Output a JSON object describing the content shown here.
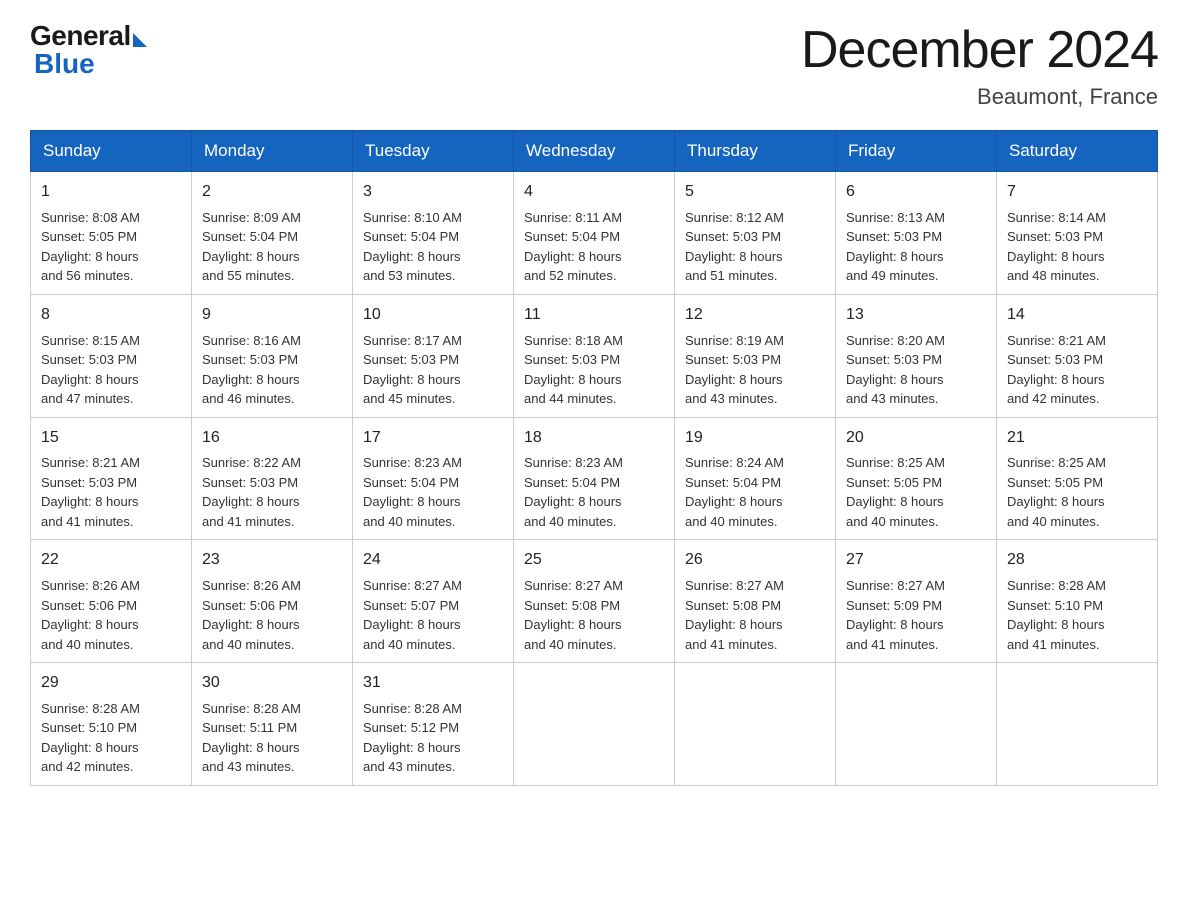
{
  "logo": {
    "general": "General",
    "blue": "Blue"
  },
  "header": {
    "month": "December 2024",
    "location": "Beaumont, France"
  },
  "weekdays": [
    "Sunday",
    "Monday",
    "Tuesday",
    "Wednesday",
    "Thursday",
    "Friday",
    "Saturday"
  ],
  "weeks": [
    [
      {
        "day": "1",
        "sunrise": "8:08 AM",
        "sunset": "5:05 PM",
        "daylight": "8 hours and 56 minutes."
      },
      {
        "day": "2",
        "sunrise": "8:09 AM",
        "sunset": "5:04 PM",
        "daylight": "8 hours and 55 minutes."
      },
      {
        "day": "3",
        "sunrise": "8:10 AM",
        "sunset": "5:04 PM",
        "daylight": "8 hours and 53 minutes."
      },
      {
        "day": "4",
        "sunrise": "8:11 AM",
        "sunset": "5:04 PM",
        "daylight": "8 hours and 52 minutes."
      },
      {
        "day": "5",
        "sunrise": "8:12 AM",
        "sunset": "5:03 PM",
        "daylight": "8 hours and 51 minutes."
      },
      {
        "day": "6",
        "sunrise": "8:13 AM",
        "sunset": "5:03 PM",
        "daylight": "8 hours and 49 minutes."
      },
      {
        "day": "7",
        "sunrise": "8:14 AM",
        "sunset": "5:03 PM",
        "daylight": "8 hours and 48 minutes."
      }
    ],
    [
      {
        "day": "8",
        "sunrise": "8:15 AM",
        "sunset": "5:03 PM",
        "daylight": "8 hours and 47 minutes."
      },
      {
        "day": "9",
        "sunrise": "8:16 AM",
        "sunset": "5:03 PM",
        "daylight": "8 hours and 46 minutes."
      },
      {
        "day": "10",
        "sunrise": "8:17 AM",
        "sunset": "5:03 PM",
        "daylight": "8 hours and 45 minutes."
      },
      {
        "day": "11",
        "sunrise": "8:18 AM",
        "sunset": "5:03 PM",
        "daylight": "8 hours and 44 minutes."
      },
      {
        "day": "12",
        "sunrise": "8:19 AM",
        "sunset": "5:03 PM",
        "daylight": "8 hours and 43 minutes."
      },
      {
        "day": "13",
        "sunrise": "8:20 AM",
        "sunset": "5:03 PM",
        "daylight": "8 hours and 43 minutes."
      },
      {
        "day": "14",
        "sunrise": "8:21 AM",
        "sunset": "5:03 PM",
        "daylight": "8 hours and 42 minutes."
      }
    ],
    [
      {
        "day": "15",
        "sunrise": "8:21 AM",
        "sunset": "5:03 PM",
        "daylight": "8 hours and 41 minutes."
      },
      {
        "day": "16",
        "sunrise": "8:22 AM",
        "sunset": "5:03 PM",
        "daylight": "8 hours and 41 minutes."
      },
      {
        "day": "17",
        "sunrise": "8:23 AM",
        "sunset": "5:04 PM",
        "daylight": "8 hours and 40 minutes."
      },
      {
        "day": "18",
        "sunrise": "8:23 AM",
        "sunset": "5:04 PM",
        "daylight": "8 hours and 40 minutes."
      },
      {
        "day": "19",
        "sunrise": "8:24 AM",
        "sunset": "5:04 PM",
        "daylight": "8 hours and 40 minutes."
      },
      {
        "day": "20",
        "sunrise": "8:25 AM",
        "sunset": "5:05 PM",
        "daylight": "8 hours and 40 minutes."
      },
      {
        "day": "21",
        "sunrise": "8:25 AM",
        "sunset": "5:05 PM",
        "daylight": "8 hours and 40 minutes."
      }
    ],
    [
      {
        "day": "22",
        "sunrise": "8:26 AM",
        "sunset": "5:06 PM",
        "daylight": "8 hours and 40 minutes."
      },
      {
        "day": "23",
        "sunrise": "8:26 AM",
        "sunset": "5:06 PM",
        "daylight": "8 hours and 40 minutes."
      },
      {
        "day": "24",
        "sunrise": "8:27 AM",
        "sunset": "5:07 PM",
        "daylight": "8 hours and 40 minutes."
      },
      {
        "day": "25",
        "sunrise": "8:27 AM",
        "sunset": "5:08 PM",
        "daylight": "8 hours and 40 minutes."
      },
      {
        "day": "26",
        "sunrise": "8:27 AM",
        "sunset": "5:08 PM",
        "daylight": "8 hours and 41 minutes."
      },
      {
        "day": "27",
        "sunrise": "8:27 AM",
        "sunset": "5:09 PM",
        "daylight": "8 hours and 41 minutes."
      },
      {
        "day": "28",
        "sunrise": "8:28 AM",
        "sunset": "5:10 PM",
        "daylight": "8 hours and 41 minutes."
      }
    ],
    [
      {
        "day": "29",
        "sunrise": "8:28 AM",
        "sunset": "5:10 PM",
        "daylight": "8 hours and 42 minutes."
      },
      {
        "day": "30",
        "sunrise": "8:28 AM",
        "sunset": "5:11 PM",
        "daylight": "8 hours and 43 minutes."
      },
      {
        "day": "31",
        "sunrise": "8:28 AM",
        "sunset": "5:12 PM",
        "daylight": "8 hours and 43 minutes."
      },
      null,
      null,
      null,
      null
    ]
  ],
  "labels": {
    "sunrise": "Sunrise:",
    "sunset": "Sunset:",
    "daylight": "Daylight:"
  }
}
